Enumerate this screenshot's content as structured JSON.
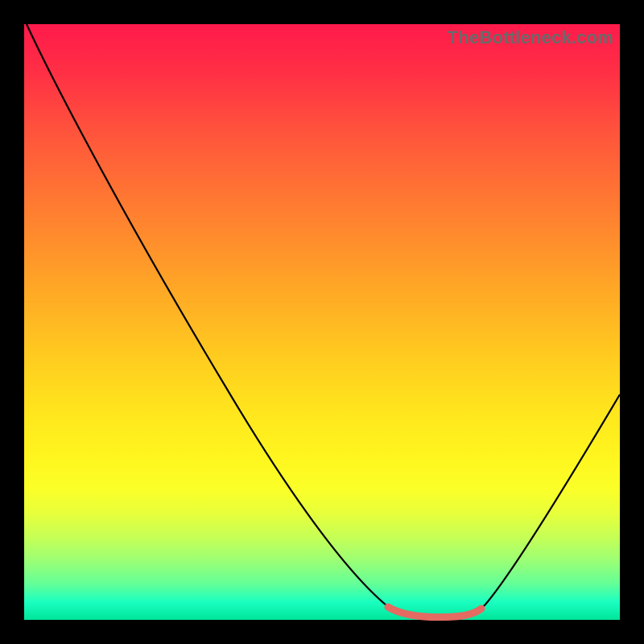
{
  "watermark": "TheBottleneck.com",
  "colors": {
    "frame": "#000000",
    "gradient_top": "#ff1a4b",
    "gradient_bottom": "#00e59a",
    "curve": "#000000",
    "highlight_segment": "#e46a62"
  },
  "chart_data": {
    "type": "line",
    "title": "",
    "xlabel": "",
    "ylabel": "",
    "xlim": [
      0,
      100
    ],
    "ylim": [
      0,
      100
    ],
    "series": [
      {
        "name": "bottleneck-curve",
        "x": [
          0,
          4,
          10,
          18,
          26,
          34,
          42,
          50,
          56,
          60,
          63,
          66,
          70,
          74,
          78,
          82,
          86,
          91,
          96,
          100
        ],
        "y": [
          100,
          94,
          85,
          73,
          61,
          49,
          37,
          25,
          14,
          7,
          3,
          1,
          0,
          0,
          1,
          3,
          8,
          17,
          28,
          38
        ]
      }
    ],
    "highlight_range_x": [
      60,
      76
    ],
    "annotations": []
  }
}
